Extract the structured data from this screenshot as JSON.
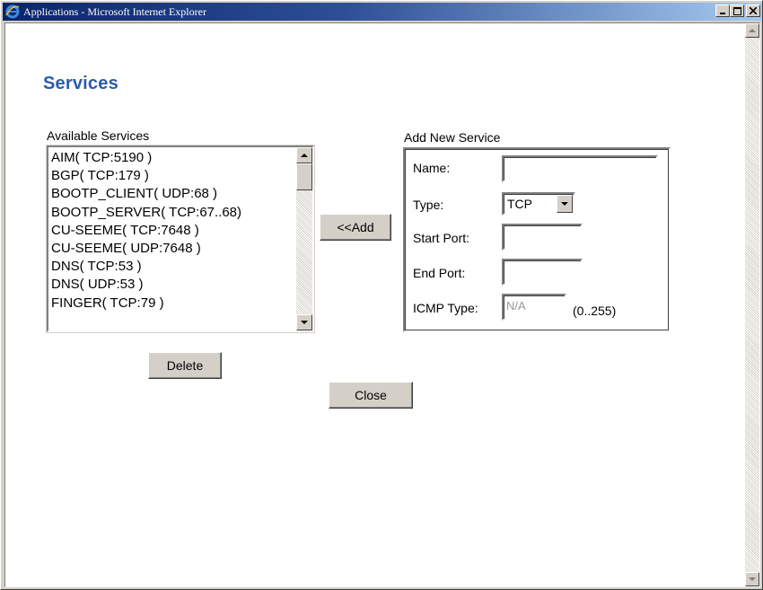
{
  "window": {
    "title": "Applications - Microsoft Internet Explorer"
  },
  "page": {
    "heading": "Services"
  },
  "available": {
    "label": "Available Services",
    "items": [
      "AIM( TCP:5190 )",
      "BGP( TCP:179 )",
      "BOOTP_CLIENT( UDP:68 )",
      "BOOTP_SERVER( TCP:67..68)",
      "CU-SEEME( TCP:7648 )",
      "CU-SEEME( UDP:7648 )",
      "DNS( TCP:53 )",
      "DNS( UDP:53 )",
      "FINGER( TCP:79 )"
    ],
    "delete_label": "Delete"
  },
  "add_button": "<<Add",
  "new_service": {
    "label": "Add New Service",
    "name_label": "Name:",
    "name_value": "",
    "type_label": "Type:",
    "type_value": "TCP",
    "start_port_label": "Start Port:",
    "start_port_value": "",
    "end_port_label": "End Port:",
    "end_port_value": "",
    "icmp_label": "ICMP Type:",
    "icmp_value": "N/A",
    "icmp_range": "(0..255)"
  },
  "close_label": "Close",
  "colors": {
    "heading": "#2b5ca8",
    "titlebar_start": "#0a246a",
    "titlebar_end": "#a6caf0",
    "button_face": "#d4d0c8"
  },
  "icons": [
    "ie-logo-icon",
    "minimize-icon",
    "maximize-icon",
    "close-icon",
    "scroll-up-icon",
    "scroll-down-icon",
    "dropdown-arrow-icon"
  ]
}
